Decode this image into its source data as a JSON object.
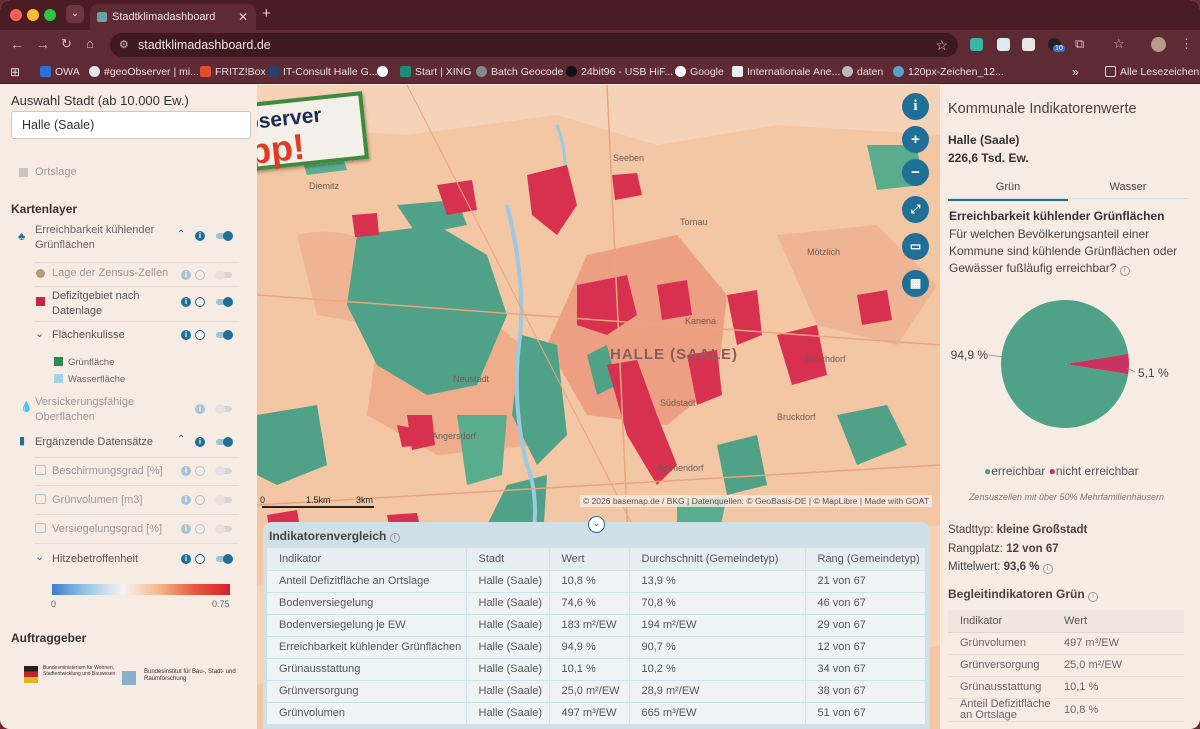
{
  "browser": {
    "tab_title": "Stadtklimadashboard",
    "url": "stadtklimadashboard.de",
    "bookmarks": [
      "OWA",
      "#geoObserver | mi...",
      "FRITZ!Box",
      "IT-Consult Halle G...",
      "Start | XING",
      "Batch Geocode",
      "24bit96 - USB HiF...",
      "Google",
      "Internationale Ane...",
      "daten",
      "120px-Zeichen_12..."
    ],
    "bookmarks_folder": "Alle Lesezeichen",
    "ext_badge": "10"
  },
  "sidebar": {
    "city_heading": "Auswahl Stadt (ab 10.000 Ew.)",
    "city_value": "Halle (Saale)",
    "ortslage": "Ortslage",
    "layers_heading": "Kartenlayer",
    "layers": {
      "l1": "Erreichbarkeit kühlender Grünflächen",
      "l2": "Lage der Zensus-Zellen",
      "l3": "Defizitgebiet nach Datenlage",
      "l4": "Flächenkulisse",
      "l4a": "Grünfläche",
      "l4b": "Wasserfläche",
      "l5": "Versickerungsfähige Oberflächen",
      "l6": "Ergänzende Datensätze",
      "l7": "Beschirmungsgrad [%]",
      "l8": "Grünvolumen [m3]",
      "l9": "Versiegelungsgrad [%]",
      "l10": "Hitzebetroffenheit"
    },
    "legend_min": "0",
    "legend_max": "0.75",
    "client_heading": "Auftraggeber",
    "client_1": "Bundesministerium für Wohnen, Stadtentwicklung und Bauwesen",
    "client_2": "Bundesinstitut für Bau-, Stadt- und Raumforschung"
  },
  "badge": {
    "line1": "#geoObserver",
    "line2": "Tipp!"
  },
  "map": {
    "city_label": "HALLE (SAALE)",
    "places": [
      "Seeben",
      "Tornau",
      "Mötzlich",
      "Diemitz",
      "Neustadt",
      "Südstadt",
      "Ammendorf",
      "Angersdorf",
      "Bruckdorf",
      "Büschdorf",
      "Kanena"
    ],
    "scale": [
      "0",
      "1.5km",
      "3km"
    ],
    "attribution": "© 2026 basemap.de / BKG | Datenquellen: © GeoBasis-DE | © MapLibre | Made with GOAT",
    "colors": {
      "deficit": "#d8304f",
      "green": "#4fa287",
      "water": "#9cc9e3"
    }
  },
  "panel": {
    "title": "Kommunale Indikatorenwerte",
    "city": "Halle (Saale)",
    "population": "226,6 Tsd. Ew.",
    "tabs": [
      "Grün",
      "Wasser"
    ],
    "ind_title": "Erreichbarkeit kühlender Grünflächen",
    "ind_question": "Für welchen Bevölkerungsanteil einer Kommune sind kühlende Grünflächen oder Gewässer fußläufig erreichbar?",
    "pie_label_1": "94,9 %",
    "pie_label_2": "5,1 %",
    "legend_1": "erreichbar",
    "legend_2": "nicht erreichbar",
    "note": "Zensuszellen mit über 50% Mehrfamilienhäusern",
    "type_label": "Stadttyp:",
    "type_value": "kleine Großstadt",
    "rank_label": "Rangplatz:",
    "rank_value": "12 von 67",
    "mean_label": "Mittelwert:",
    "mean_value": "93,6 %",
    "beg_title": "Begleitindikatoren Grün",
    "beg_header": [
      "Indikator",
      "Wert"
    ],
    "beg_rows": [
      [
        "Grünvolumen",
        "497 m³/EW"
      ],
      [
        "Grünversorgung",
        "25,0 m²/EW"
      ],
      [
        "Grünausstattung",
        "10,1 %"
      ],
      [
        "Anteil Defizitfläche an Ortslage",
        "10,8 %"
      ]
    ]
  },
  "chart_data": {
    "type": "pie",
    "labels": [
      "erreichbar",
      "nicht erreichbar"
    ],
    "values": [
      94.9,
      5.1
    ],
    "colors": [
      "#4fa287",
      "#c8335f"
    ]
  },
  "table": {
    "title": "Indikatorenvergleich",
    "header": [
      "Indikator",
      "Stadt",
      "Wert",
      "Durchschnitt (Gemeindetyp)",
      "Rang (Gemeindetyp)"
    ],
    "rows": [
      [
        "Anteil Defizitfläche an Ortslage",
        "Halle (Saale)",
        "10,8 %",
        "13,9 %",
        "21 von 67"
      ],
      [
        "Bodenversiegelung",
        "Halle (Saale)",
        "74,6 %",
        "70,8 %",
        "46 von 67"
      ],
      [
        "Bodenversiegelung je EW",
        "Halle (Saale)",
        "183 m²/EW",
        "194 m²/EW",
        "29 von 67"
      ],
      [
        "Erreichbarkeit kühlender Grünflächen",
        "Halle (Saale)",
        "94,9 %",
        "90,7 %",
        "12 von 67"
      ],
      [
        "Grünausstattung",
        "Halle (Saale)",
        "10,1 %",
        "10,2 %",
        "34 von 67"
      ],
      [
        "Grünversorgung",
        "Halle (Saale)",
        "25,0 m²/EW",
        "28,9 m²/EW",
        "38 von 67"
      ],
      [
        "Grünvolumen",
        "Halle (Saale)",
        "497 m³/EW",
        "665 m³/EW",
        "51 von 67"
      ]
    ]
  }
}
